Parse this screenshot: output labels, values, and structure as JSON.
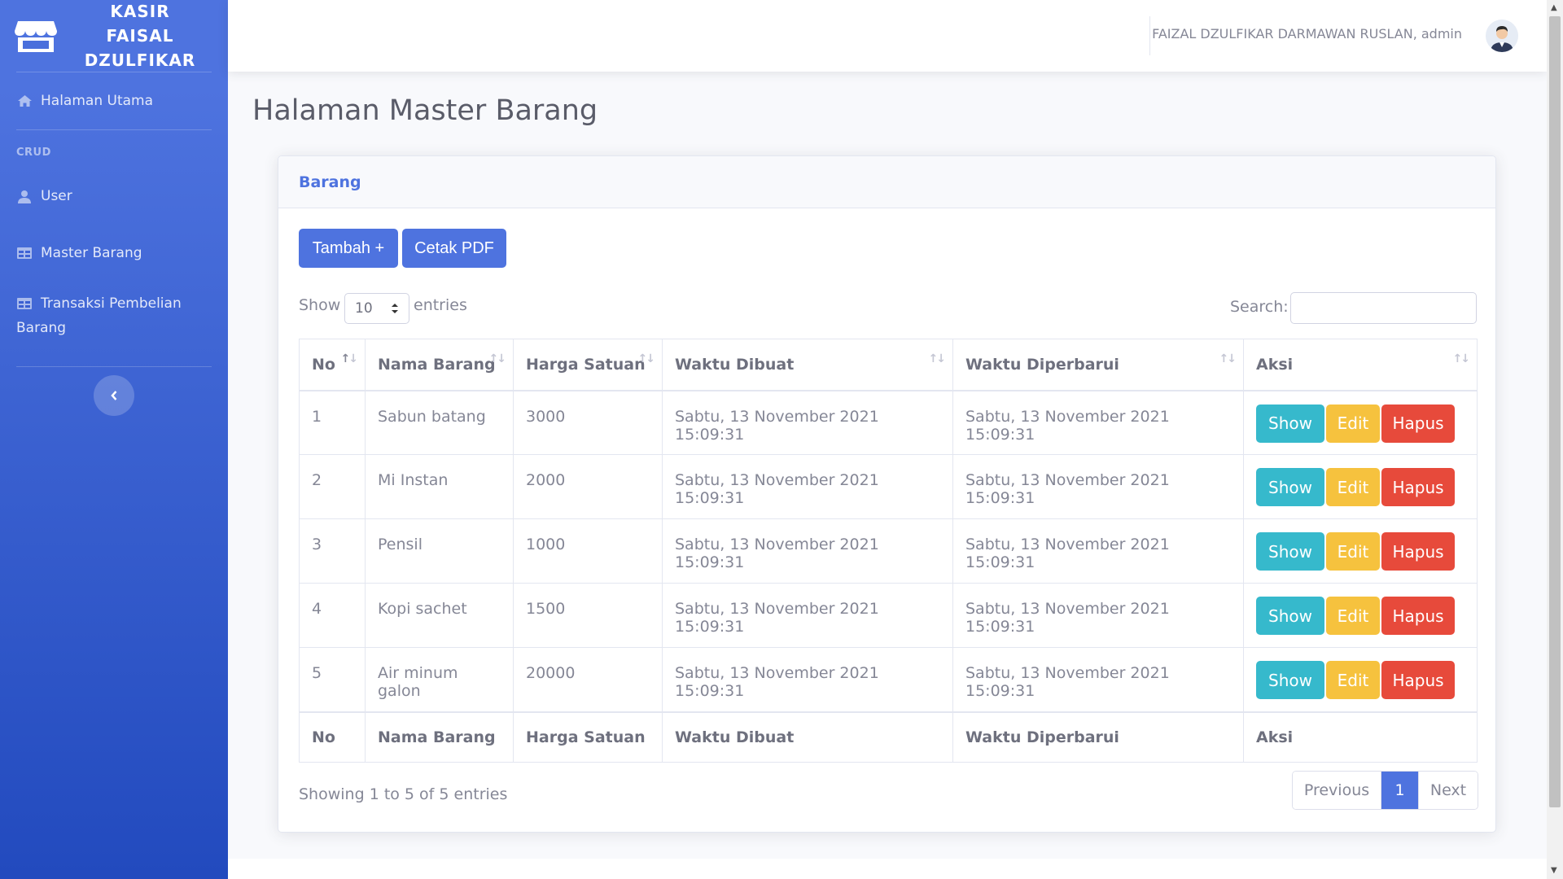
{
  "sidebar": {
    "brand": "KASIR FAISAL DZULFIKAR",
    "brand_icon": "store-icon",
    "items": [
      {
        "label": "Halaman Utama",
        "icon": "home-icon"
      },
      {
        "label": "User",
        "icon": "user-icon"
      },
      {
        "label": "Master Barang",
        "icon": "table-icon"
      },
      {
        "label": "Transaksi Pembelian Barang",
        "icon": "table-icon"
      }
    ],
    "heading": "CRUD",
    "toggle_icon": "chevron-left-icon"
  },
  "topbar": {
    "user_name": "FAIZAL DZULFIKAR DARMAWAN RUSLAN, admin"
  },
  "page": {
    "title": "Halaman Master Barang"
  },
  "card": {
    "header": "Barang",
    "buttons": {
      "add": "Tambah +",
      "pdf": "Cetak PDF"
    },
    "length": {
      "show": "Show",
      "value": "10",
      "entries": "entries"
    },
    "search_label": "Search:",
    "columns": [
      "No",
      "Nama Barang",
      "Harga Satuan",
      "Waktu Dibuat",
      "Waktu Diperbarui",
      "Aksi"
    ],
    "rows": [
      {
        "no": "1",
        "nama": "Sabun batang",
        "harga": "3000",
        "dibuat": "Sabtu, 13 November 2021 15:09:31",
        "diperbarui": "Sabtu, 13 November 2021 15:09:31"
      },
      {
        "no": "2",
        "nama": "Mi Instan",
        "harga": "2000",
        "dibuat": "Sabtu, 13 November 2021 15:09:31",
        "diperbarui": "Sabtu, 13 November 2021 15:09:31"
      },
      {
        "no": "3",
        "nama": "Pensil",
        "harga": "1000",
        "dibuat": "Sabtu, 13 November 2021 15:09:31",
        "diperbarui": "Sabtu, 13 November 2021 15:09:31"
      },
      {
        "no": "4",
        "nama": "Kopi sachet",
        "harga": "1500",
        "dibuat": "Sabtu, 13 November 2021 15:09:31",
        "diperbarui": "Sabtu, 13 November 2021 15:09:31"
      },
      {
        "no": "5",
        "nama": "Air minum galon",
        "harga": "20000",
        "dibuat": "Sabtu, 13 November 2021 15:09:31",
        "diperbarui": "Sabtu, 13 November 2021 15:09:31"
      }
    ],
    "actions": {
      "show": "Show",
      "edit": "Edit",
      "delete": "Hapus"
    },
    "info": "Showing 1 to 5 of 5 entries",
    "pagination": {
      "previous": "Previous",
      "current": "1",
      "next": "Next"
    }
  },
  "colors": {
    "primary": "#4e73df",
    "info": "#36b9cc",
    "warning": "#f6c23e",
    "danger": "#e74a3b"
  }
}
